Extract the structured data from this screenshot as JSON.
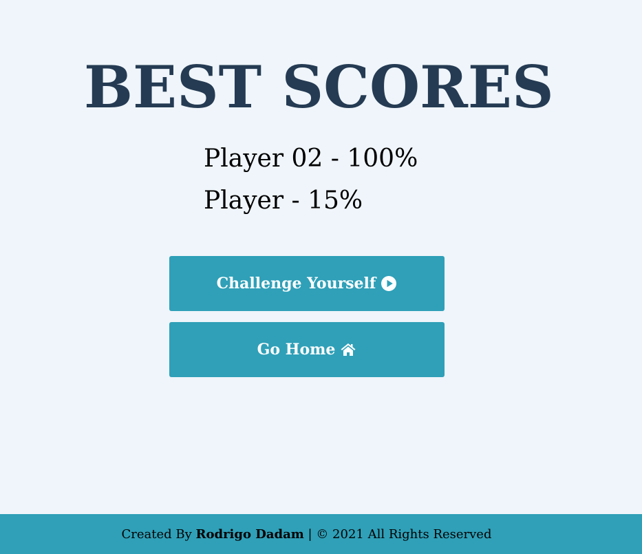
{
  "page": {
    "title": "BEST SCORES"
  },
  "scores": [
    {
      "text": "Player 02 - 100%"
    },
    {
      "text": "Player - 15%"
    }
  ],
  "buttons": {
    "challenge_label": "Challenge Yourself",
    "challenge_icon": "play-circle-icon",
    "home_label": "Go Home",
    "home_icon": "home-icon"
  },
  "footer": {
    "prefix": "Created By ",
    "author": "Rodrigo Dadam",
    "suffix": " | © 2021 All Rights Reserved"
  },
  "colors": {
    "background": "#eff5fa",
    "title": "#253b53",
    "accent": "#2fa0b8",
    "button_text": "#ffffff"
  }
}
